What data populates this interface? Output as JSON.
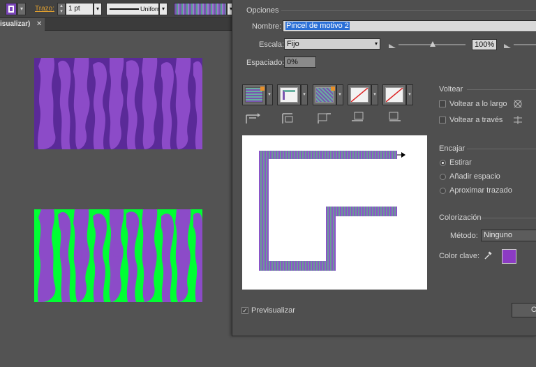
{
  "toolbar": {
    "stroke_label": "Trazo:",
    "stroke_weight": "1 pt",
    "stroke_style": "Uniforme"
  },
  "document_tab": {
    "title": "isualizar)",
    "close": "✕"
  },
  "dialog": {
    "options_section": "Opciones",
    "name_label": "Nombre:",
    "name_value": "Pincel de motivo 2",
    "scale_label": "Escala:",
    "scale_value": "Fijo",
    "scale_percent": "100%",
    "spacing_label": "Espaciado:",
    "spacing_value": "0%",
    "flip_section": "Voltear",
    "flip_along": "Voltear a lo largo",
    "flip_across": "Voltear a través",
    "fit_section": "Encajar",
    "fit_stretch": "Estirar",
    "fit_add_space": "Añadir espacio",
    "fit_approx": "Aproximar trazado",
    "colorization_section": "Colorización",
    "method_label": "Método:",
    "method_value": "Ninguno",
    "key_color_label": "Color clave:",
    "preview_label": "Previsualizar",
    "ok_button": "O"
  },
  "colors": {
    "purple": "#8c4bc8",
    "dark_purple": "#5a2a98",
    "green": "#00ff33",
    "key_color": "#8c3bc4",
    "selection_blue": "#2a6fd6"
  },
  "icons": [
    "pencil-icon",
    "eyedropper-icon",
    "flip-along-icon",
    "flip-across-icon",
    "chevron-down-icon",
    "close-icon"
  ]
}
